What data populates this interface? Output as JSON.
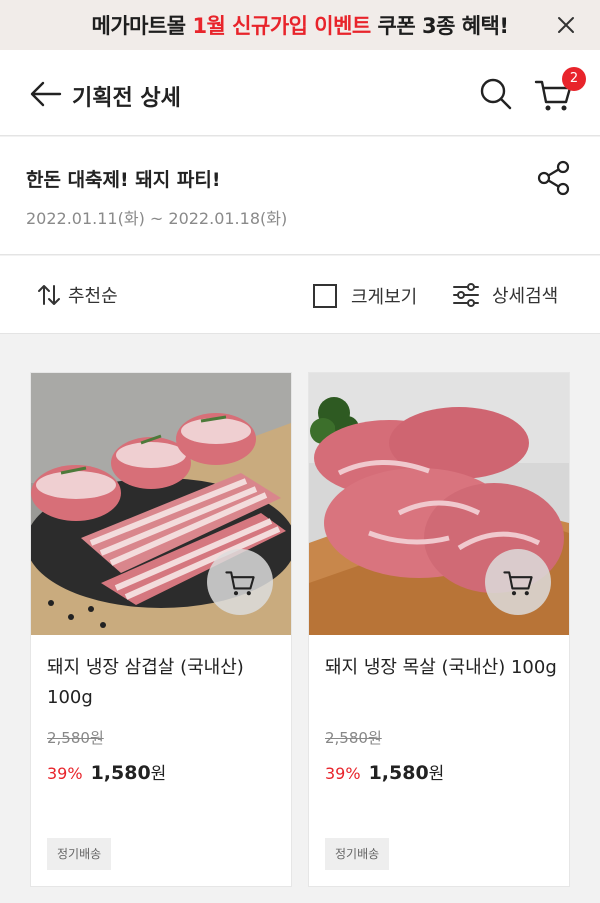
{
  "banner": {
    "text_prefix": "메가마트몰 ",
    "text_highlight": "1월 신규가입 이벤트",
    "text_suffix": " 쿠폰 3종 혜택!",
    "close_icon": "close-icon"
  },
  "header": {
    "title": "기획전 상세",
    "back_icon": "back-arrow-icon",
    "search_icon": "search-icon",
    "cart_icon": "cart-icon",
    "cart_count": "2"
  },
  "event": {
    "title": "한돈 대축제! 돼지 파티!",
    "period": "2022.01.11(화) ~ 2022.01.18(화)",
    "share_icon": "share-icon"
  },
  "toolbar": {
    "sort_label": "추천순",
    "sort_icon": "sort-icon",
    "big_view_label": "크게보기",
    "big_view_checked": false,
    "filter_label": "상세검색",
    "filter_icon": "filter-sliders-icon"
  },
  "products": [
    {
      "name": "돼지 냉장 삼겹살 (국내산) 100g",
      "original_price": "2,580원",
      "discount": "39%",
      "sale_price": "1,580",
      "currency": "원",
      "tag": "정기배송",
      "image_subject": "pork belly on slate board",
      "cart_icon": "cart-icon"
    },
    {
      "name": "돼지 냉장 목살 (국내산) 100g",
      "original_price": "2,580원",
      "discount": "39%",
      "sale_price": "1,580",
      "currency": "원",
      "tag": "정기배송",
      "image_subject": "pork neck on wooden board",
      "cart_icon": "cart-icon"
    }
  ],
  "colors": {
    "accent": "#e8242b",
    "banner_bg": "#f1ece9",
    "page_bg": "#f2f2f2"
  }
}
